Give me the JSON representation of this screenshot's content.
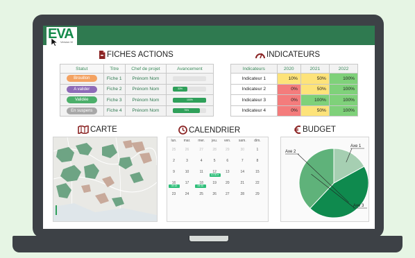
{
  "logo": {
    "name": "EVA",
    "version": "Version M"
  },
  "fiches": {
    "title": "FICHES ACTIONS",
    "headers": [
      "Statut",
      "Titre",
      "Chef de projet",
      "Avancement"
    ],
    "rows": [
      {
        "status": "Brouillon",
        "status_color": "#f4a261",
        "title": "Fiche 1",
        "chef": "Prénom Nom",
        "progress": 0,
        "progress_label": ""
      },
      {
        "status": "A valider",
        "status_color": "#8e6bb8",
        "title": "Fiche 2",
        "chef": "Prénom Nom",
        "progress": 0.42,
        "progress_label": "33%"
      },
      {
        "status": "Validée",
        "status_color": "#4caf6a",
        "title": "Fiche 3",
        "chef": "Prénom Nom",
        "progress": 1.0,
        "progress_label": "100%"
      },
      {
        "status": "En suspens",
        "status_color": "#a8a8a8",
        "title": "Fiche 4",
        "chef": "Prénom Nom",
        "progress": 0.8,
        "progress_label": "75%"
      }
    ]
  },
  "indicateurs": {
    "title": "INDICATEURS",
    "headers": [
      "Indicateurs",
      "2020",
      "2021",
      "2022"
    ],
    "rows": [
      {
        "name": "Indicateur 1",
        "cells": [
          {
            "v": "10%",
            "c": "#fde37a"
          },
          {
            "v": "50%",
            "c": "#fde37a"
          },
          {
            "v": "100%",
            "c": "#7fd17a"
          }
        ]
      },
      {
        "name": "Indicateur 2",
        "cells": [
          {
            "v": "0%",
            "c": "#f47c7c"
          },
          {
            "v": "50%",
            "c": "#fde37a"
          },
          {
            "v": "100%",
            "c": "#7fd17a"
          }
        ]
      },
      {
        "name": "Indicateur 3",
        "cells": [
          {
            "v": "0%",
            "c": "#f47c7c"
          },
          {
            "v": "100%",
            "c": "#7fd17a"
          },
          {
            "v": "100%",
            "c": "#7fd17a"
          }
        ]
      },
      {
        "name": "Indicateur 4",
        "cells": [
          {
            "v": "0%",
            "c": "#f47c7c"
          },
          {
            "v": "50%",
            "c": "#fde37a"
          },
          {
            "v": "100%",
            "c": "#7fd17a"
          }
        ]
      }
    ]
  },
  "carte": {
    "title": "CARTE"
  },
  "calendrier": {
    "title": "CALENDRIER",
    "days": [
      "lun.",
      "mar.",
      "mer.",
      "jeu.",
      "ven.",
      "sam.",
      "dim."
    ],
    "weeks": [
      [
        {
          "d": "25",
          "o": true
        },
        {
          "d": "26",
          "o": true
        },
        {
          "d": "27",
          "o": true
        },
        {
          "d": "28",
          "o": true
        },
        {
          "d": "29",
          "o": true
        },
        {
          "d": "30",
          "o": true
        },
        {
          "d": "1"
        }
      ],
      [
        {
          "d": "2"
        },
        {
          "d": "3"
        },
        {
          "d": "4"
        },
        {
          "d": "5"
        },
        {
          "d": "6"
        },
        {
          "d": "7"
        },
        {
          "d": "8"
        }
      ],
      [
        {
          "d": "9"
        },
        {
          "d": "10"
        },
        {
          "d": "11"
        },
        {
          "d": "12",
          "ev": "10:30 e"
        },
        {
          "d": "13"
        },
        {
          "d": "14"
        },
        {
          "d": "15"
        }
      ],
      [
        {
          "d": "16",
          "ev": "09:15"
        },
        {
          "d": "17"
        },
        {
          "d": "18",
          "ev": "09:30"
        },
        {
          "d": "19"
        },
        {
          "d": "20"
        },
        {
          "d": "21"
        },
        {
          "d": "22"
        }
      ],
      [
        {
          "d": "23"
        },
        {
          "d": "24"
        },
        {
          "d": "25"
        },
        {
          "d": "26"
        },
        {
          "d": "27"
        },
        {
          "d": "28"
        },
        {
          "d": "29"
        }
      ]
    ]
  },
  "budget": {
    "title": "BUDGET"
  },
  "chart_data": {
    "type": "pie",
    "categories": [
      "Axe 1",
      "Axe 2",
      "Axe 3"
    ],
    "values": [
      17,
      45,
      38
    ],
    "colors": [
      "#a6cfb2",
      "#0f8a4e",
      "#5fb27a"
    ]
  }
}
